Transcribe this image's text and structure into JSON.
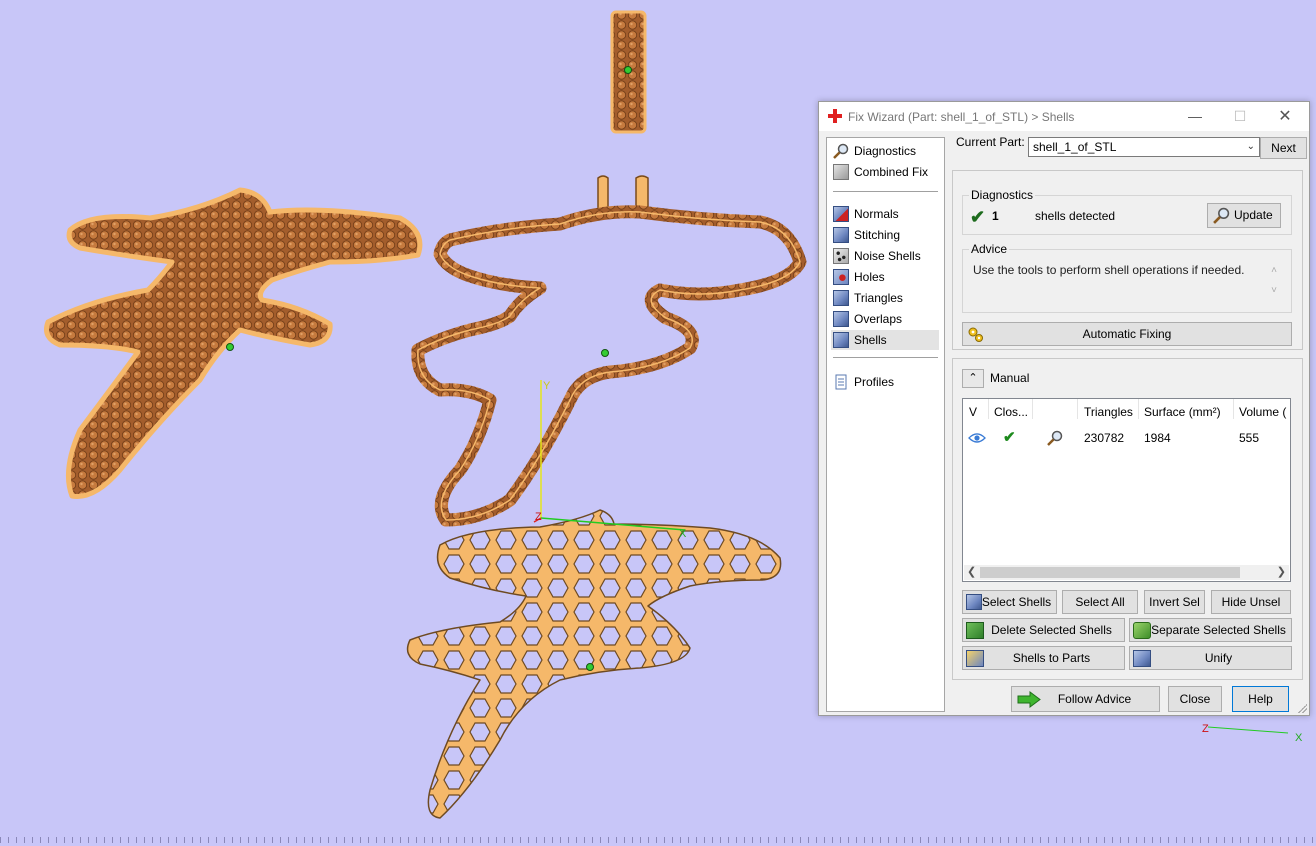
{
  "window": {
    "title": "Fix Wizard (Part: shell_1_of_STL) > Shells",
    "icon": "red-cross-icon"
  },
  "nav": {
    "items": [
      {
        "label": "Diagnostics",
        "icon": "magnifier-icon"
      },
      {
        "label": "Combined Fix",
        "icon": "cube-icon"
      },
      {
        "label": "Normals",
        "icon": "normals-cube-icon"
      },
      {
        "label": "Stitching",
        "icon": "stitching-cube-icon"
      },
      {
        "label": "Noise Shells",
        "icon": "noise-shells-icon"
      },
      {
        "label": "Holes",
        "icon": "holes-cube-icon"
      },
      {
        "label": "Triangles",
        "icon": "triangles-cube-icon"
      },
      {
        "label": "Overlaps",
        "icon": "overlaps-cube-icon"
      },
      {
        "label": "Shells",
        "icon": "shells-cube-icon"
      },
      {
        "label": "Profiles",
        "icon": "document-icon"
      }
    ],
    "active": "Shells"
  },
  "current_part": {
    "label": "Current Part:",
    "value": "shell_1_of_STL",
    "next_label": "Next"
  },
  "diagnostics": {
    "caption": "Diagnostics",
    "count": "1",
    "text": "shells detected",
    "update_label": "Update"
  },
  "advice": {
    "caption": "Advice",
    "text": "Use the tools to perform shell operations if needed."
  },
  "automatic_fixing_label": "Automatic Fixing",
  "manual": {
    "label": "Manual",
    "columns": [
      "V",
      "Clos...",
      "",
      "Triangles",
      "Surface (mm²)",
      "Volume ("
    ],
    "rows": [
      {
        "visible_icon": "eye-icon",
        "closed_icon": "green-check-icon",
        "zoom_icon": "magnifier-icon",
        "triangles": "230782",
        "surface": "1984",
        "volume": "555"
      }
    ]
  },
  "buttons": {
    "select_shells": "Select Shells",
    "select_all": "Select All",
    "invert_sel": "Invert Sel",
    "hide_unsel": "Hide Unsel",
    "delete_selected_shells": "Delete Selected Shells",
    "separate_selected_shells": "Separate Selected Shells",
    "shells_to_parts": "Shells to Parts",
    "unify": "Unify",
    "follow_advice": "Follow Advice",
    "close": "Close",
    "help": "Help"
  },
  "viewport": {
    "background": "#c8c6f8",
    "axis_labels": {
      "y": "Y",
      "z": "Z",
      "x": "X"
    },
    "mini_axis_labels": {
      "z": "Z",
      "x": "X"
    }
  },
  "colors": {
    "part_fill": "#f5b86a",
    "part_dark": "#9a5424",
    "accent": "#0078d7",
    "check": "#1d8a1d"
  }
}
